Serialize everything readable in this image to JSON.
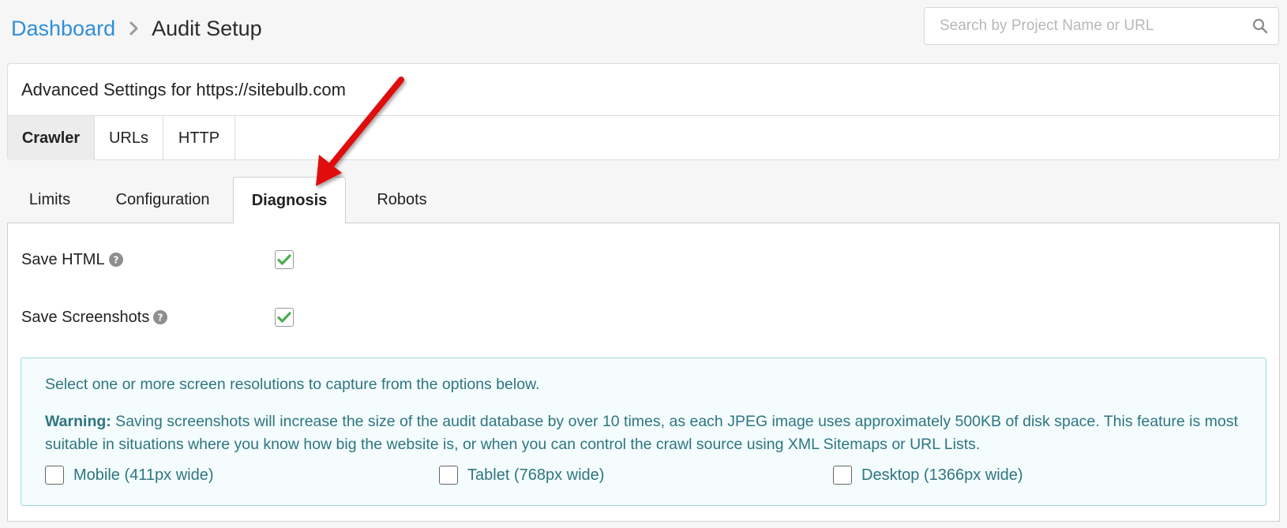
{
  "breadcrumb": {
    "home": "Dashboard",
    "current": "Audit Setup"
  },
  "search": {
    "placeholder": "Search by Project Name or URL",
    "value": ""
  },
  "panel": {
    "title": "Advanced Settings for https://sitebulb.com",
    "tabs": [
      {
        "label": "Crawler",
        "active": true
      },
      {
        "label": "URLs",
        "active": false
      },
      {
        "label": "HTTP",
        "active": false
      }
    ]
  },
  "sub_tabs": [
    {
      "label": "Limits",
      "active": false
    },
    {
      "label": "Configuration",
      "active": false
    },
    {
      "label": "Diagnosis",
      "active": true
    },
    {
      "label": "Robots",
      "active": false
    }
  ],
  "settings": [
    {
      "label": "Save HTML",
      "checked": true
    },
    {
      "label": "Save Screenshots",
      "checked": true
    }
  ],
  "info_box": {
    "line1": "Select one or more screen resolutions to capture from the options below.",
    "warning_label": "Warning:",
    "warning_text": " Saving screenshots will increase the size of the audit database by over 10 times, as each JPEG image uses approximately 500KB of disk space. This feature is most suitable in situations where you know how big the website is, or when you can control the crawl source using XML Sitemaps or URL Lists.",
    "resolutions": [
      {
        "label": "Mobile (411px wide)",
        "checked": false
      },
      {
        "label": "Tablet (768px wide)",
        "checked": false
      },
      {
        "label": "Desktop (1366px wide)",
        "checked": false
      }
    ]
  },
  "colors": {
    "link": "#2f8fd8",
    "check": "#4cae4c",
    "info_text": "#2d7680",
    "info_border": "#9ed9de",
    "annotation_arrow": "#e01010"
  },
  "icons": {
    "breadcrumb_separator": "chevron-right-icon",
    "search": "search-icon",
    "help": "question-circle-icon",
    "check": "checkmark-icon"
  }
}
